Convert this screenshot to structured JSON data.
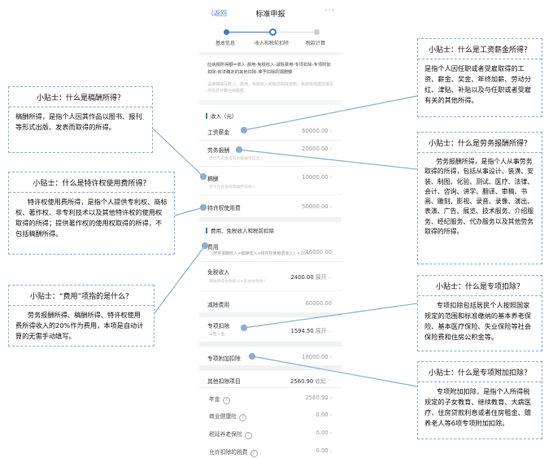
{
  "header": {
    "back": "〈返回",
    "title": "标准申报",
    "more": "···"
  },
  "steps": [
    {
      "label": "基本信息",
      "state": "done"
    },
    {
      "label": "收入和税前扣除",
      "state": "current"
    },
    {
      "label": "税款计算",
      "state": "todo"
    }
  ],
  "notice": {
    "formula": "应纳税所得额=收入-费用-免税收入-减除费用-专项扣除-专项附加扣除-依法确定的其他扣除-准予扣除的捐赠额",
    "sub": "请准确填写收入、费用、免税收入和税前扣除金额，系统将根据您填写的信息计算应纳税额"
  },
  "income": {
    "heading": "收入（元）",
    "rows": [
      {
        "label": "工资薪金",
        "value": "60000.00",
        "hint": ""
      },
      {
        "label": "劳务报酬",
        "value": "20000.00",
        "hint": "您可在此填报劳务报酬所得收入"
      },
      {
        "label": "稿酬",
        "value": "10000.00",
        "hint": "您可在此填报稿酬所得收入"
      },
      {
        "label": "特许权使用费",
        "value": "50000.00",
        "hint": ""
      }
    ]
  },
  "deduct": {
    "heading": "费用、免税收入和税前扣除",
    "fee": {
      "label": "费用",
      "value": "16000.00",
      "sub": "（劳务报酬收入+稿酬收入+特许权使用费收入）×20%"
    },
    "exempt": {
      "label": "免税收入",
      "value": "2400.00",
      "action": "展开",
      "sub": "稿酬所得免税部分+其他免税收入"
    },
    "basic": {
      "label": "减除费用",
      "value": "60000.00"
    },
    "special": {
      "label": "专项扣除",
      "value": "1594.50",
      "action": "展开",
      "sub": "三险一金"
    },
    "additional": {
      "label": "专项附加扣除",
      "value": "18000.00"
    },
    "other": {
      "label": "其他扣除项目",
      "value": "2560.90",
      "action": "收起"
    },
    "other_items": [
      {
        "label": "年金",
        "value": "2560.90"
      },
      {
        "label": "商业健康险",
        "value": "0.00"
      },
      {
        "label": "税延养老保险",
        "value": "0.00"
      },
      {
        "label": "允许扣除的税费",
        "value": "0.00"
      }
    ]
  },
  "tips": {
    "royalty": {
      "title": "小贴士：什么是稿酬所得？",
      "body": "稿酬所得，是指个人因其作品以图书、报刊等形式出版、发表而取得的所得。"
    },
    "franchise": {
      "title": "小贴士：什么是特许权使用费所得？",
      "body": "特许权使用费所得，是指个人提供专利权、商标权、著作权、非专利技术以及其他特许权的使用权取得的所得；提供著作权的使用权取得的所得，不包括稿酬所得。"
    },
    "fee": {
      "title": "小贴士：“费用”项指的是什么？",
      "body": "劳务报酬所得、稿酬所得、特许权使用费所得收入的20%作为费用，本项是自动计算的无需手动填写。"
    },
    "wage": {
      "title": "小贴士：什么是工资薪金所得？",
      "body": "是指个人因任职或者受雇取得的工资、薪金、奖金、年终加薪、劳动分红、津贴、补贴以及与任职或者受雇有关的其他所得。"
    },
    "labor": {
      "title": "小贴士：什么是劳务报酬所得？",
      "body": "劳务报酬所得，是指个人从事劳务取得的所得，包括从事设计、装潢、安装、制图、化验、测试、医疗、法律、会计、咨询、讲学、翻译、审稿、书画、雕刻、影视、录音、录像、演出、表演、广告、展览、技术服务、介绍服务、经纪服务、代办服务以及其他劳务取得的所得。"
    },
    "special": {
      "title": "小贴士：什么是专项扣除？",
      "body": "专项扣除包括居民个人按照国家规定的范围和标准缴纳的基本养老保险、基本医疗保险、失业保险等社会保险费和住房公积金等。"
    },
    "additional": {
      "title": "小贴士：什么是专项附加扣除？",
      "body": "专项附加扣除，是指个人所得税规定的子女教育、继续教育、大病医疗、住房贷款利息或者住房租金、赡养老人等6项专项附加扣除。"
    }
  },
  "colors": {
    "accent": "#3a7bd5",
    "connector": "#8aaed6"
  }
}
